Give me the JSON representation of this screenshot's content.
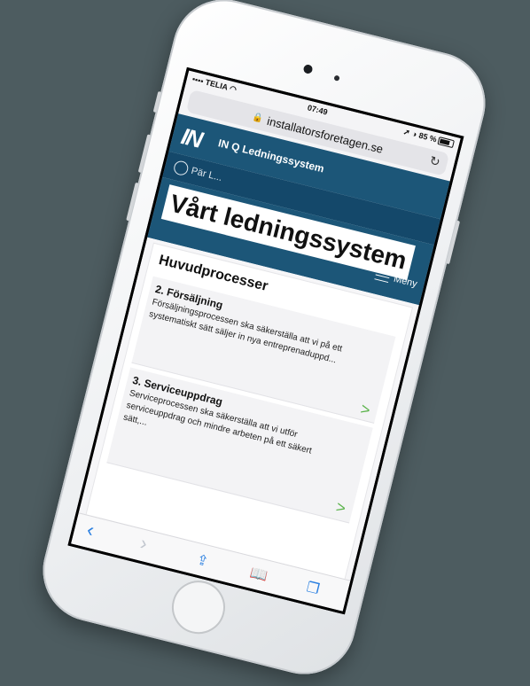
{
  "status_bar": {
    "carrier": "TELIA",
    "time": "07:49",
    "battery": "85 %"
  },
  "browser": {
    "url": "installatorsforetagen.se",
    "reload_icon": "reload-icon",
    "lock_icon": "lock-icon"
  },
  "site": {
    "logo": "IN",
    "title": "IN Q Ledningssystem",
    "user": "Pär L...",
    "menu_label": "Meny"
  },
  "page": {
    "title": "Vårt ledningssystem",
    "section_title": "Huvudprocesser",
    "items": [
      {
        "title": "2. Försäljning",
        "text": "Försäljningsprocessen ska säkerställa att vi på ett systematiskt sätt säljer in nya entreprenaduppd..."
      },
      {
        "title": "3. Serviceuppdrag",
        "text": "Serviceprocessen ska säkerställa att vi utför serviceuppdrag och mindre arbeten på ett säkert sätt,..."
      }
    ]
  },
  "toolbar": {
    "back": "‹",
    "forward": "›",
    "share": "⇪",
    "bookmarks": "📖",
    "tabs": "❐"
  },
  "colors": {
    "header": "#1c5678",
    "chevron": "#5ab34a",
    "link": "#2a7fe0"
  }
}
